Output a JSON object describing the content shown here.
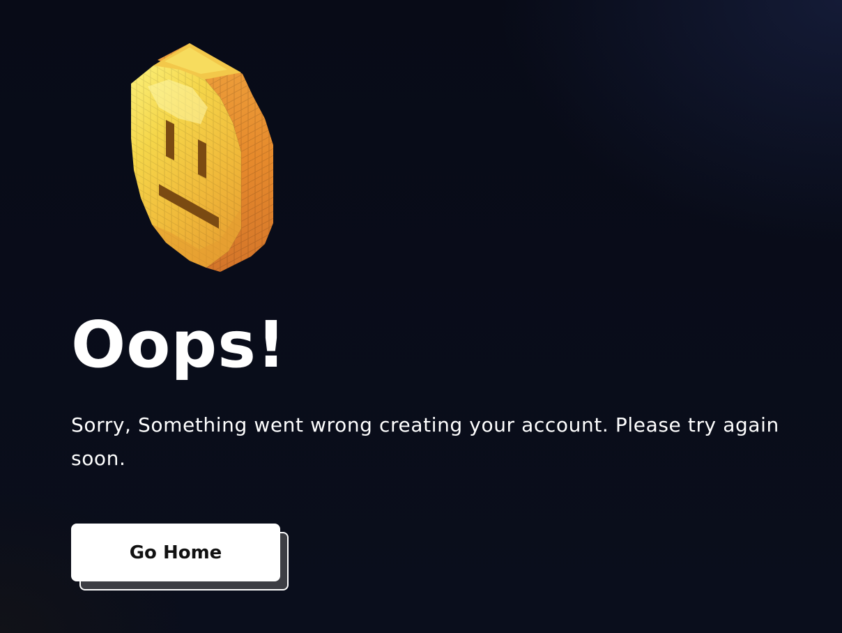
{
  "error": {
    "title": "Oops!",
    "message": "Sorry, Something went wrong creating your account. Please try again soon."
  },
  "actions": {
    "go_home_label": "Go Home"
  },
  "illustration": {
    "icon": "pixel-neutral-face-coin-icon",
    "colors": {
      "face_light": "#f7e25a",
      "face_mid": "#f2c23a",
      "face_dark": "#e9a733",
      "edge": "#e4882b",
      "edge_dark": "#c9701f",
      "features": "#7a4a12"
    }
  },
  "theme": {
    "background": "#0a0e1c",
    "text": "#ffffff",
    "button_bg": "#ffffff",
    "button_text": "#111111",
    "button_shadow": "#3d3e44"
  }
}
